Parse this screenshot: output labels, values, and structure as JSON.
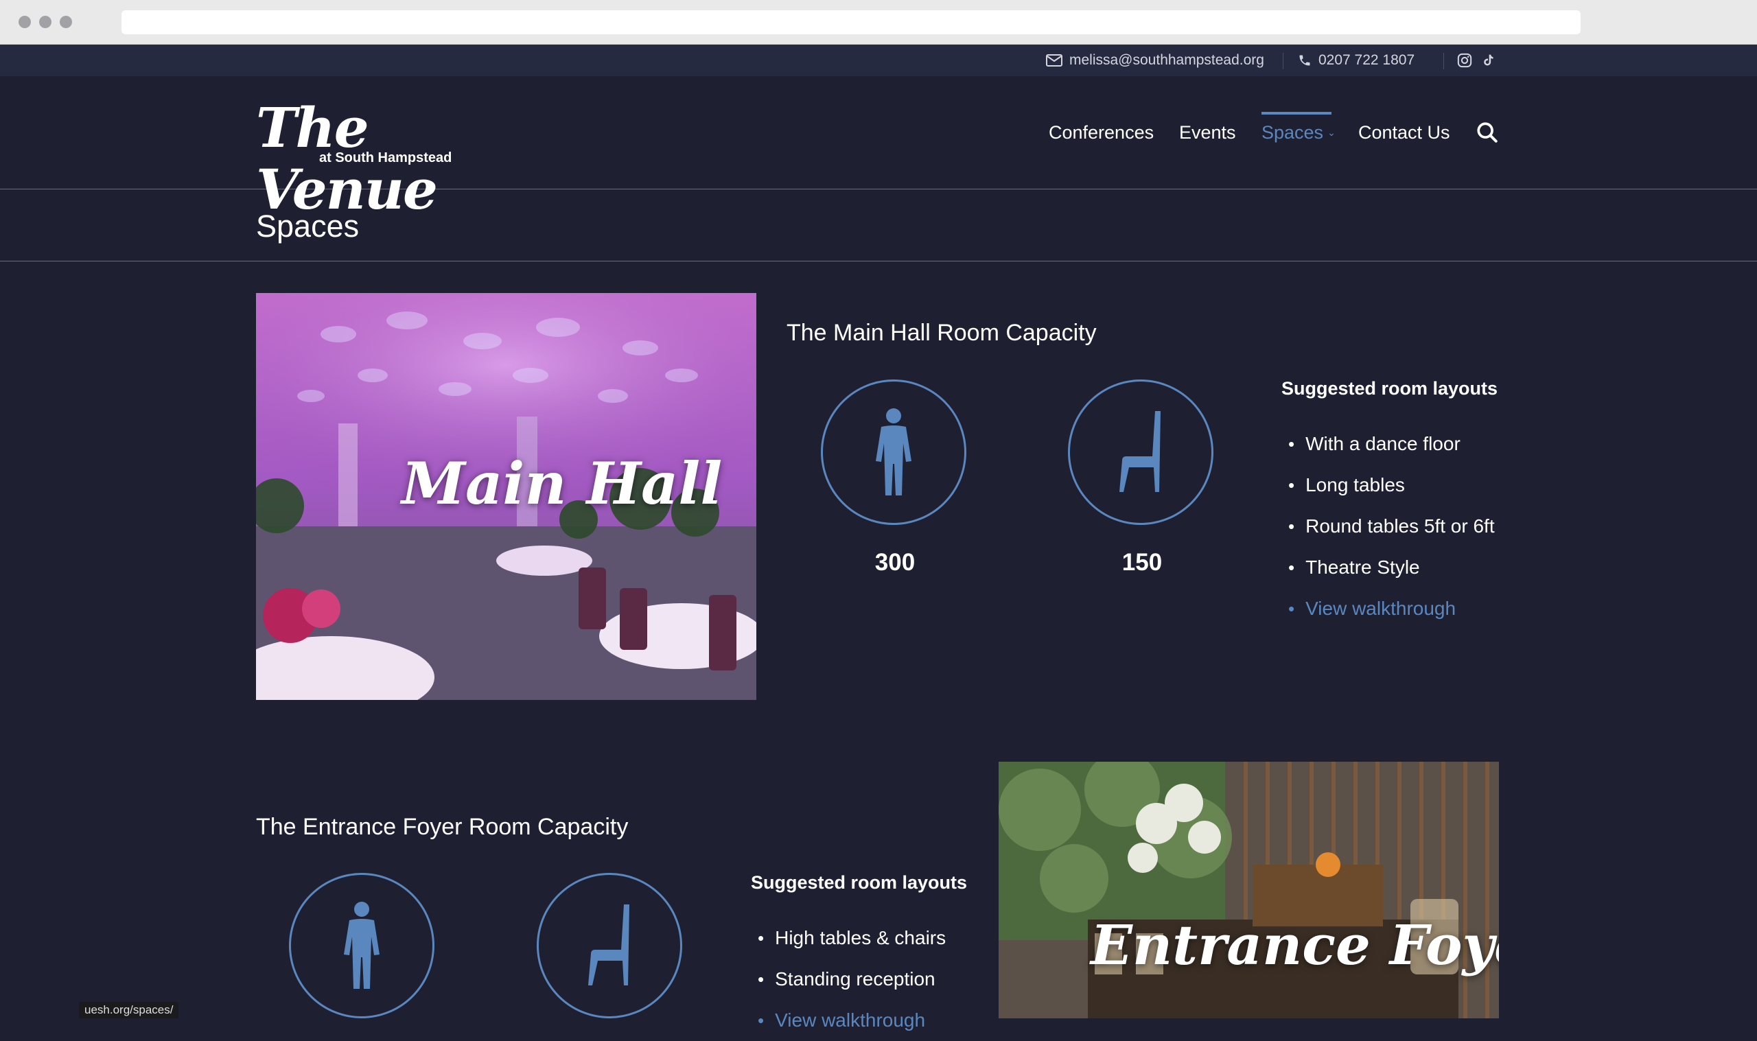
{
  "topbar": {
    "email": "melissa@southhampstead.org",
    "phone": "0207 722 1807",
    "social_icons": [
      "instagram-icon",
      "tiktok-icon"
    ]
  },
  "logo": {
    "main": "The Venue",
    "sub": "at South Hampstead"
  },
  "nav": {
    "items": [
      "Conferences",
      "Events",
      "Spaces",
      "Contact Us"
    ],
    "active": "Spaces",
    "search_icon": "search-icon"
  },
  "page": {
    "title": "Spaces"
  },
  "main_hall": {
    "image_label": "Main Hall",
    "heading": "The Main Hall Room Capacity",
    "standing": "300",
    "seated": "150",
    "layouts_heading": "Suggested room layouts",
    "layouts": [
      "With a dance floor",
      "Long tables",
      "Round tables 5ft or 6ft",
      "Theatre Style"
    ],
    "walkthrough": "View walkthrough"
  },
  "foyer": {
    "image_label": "Entrance Foyer",
    "heading": "The Entrance Foyer Room Capacity",
    "layouts_heading": "Suggested room layouts",
    "layouts": [
      "High tables & chairs",
      "Standing reception"
    ],
    "walkthrough": "View walkthrough"
  },
  "status_bar": "uesh.org/spaces/",
  "colors": {
    "background": "#1e2032",
    "topbar": "#262a41",
    "accent": "#5b87bf"
  }
}
